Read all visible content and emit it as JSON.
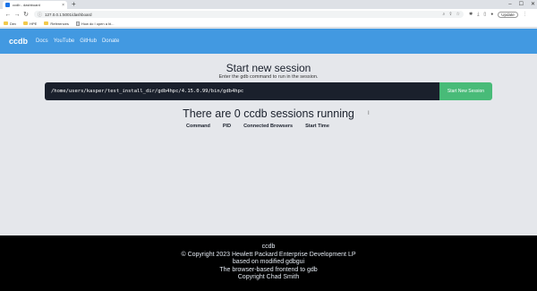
{
  "browser": {
    "tab_title": "ccdb - dashboard",
    "tab_close": "×",
    "new_tab": "+",
    "url": "127.0.0.1:5001/dashboard",
    "update_label": "Update",
    "bookmarks": [
      "Dev",
      "HPE",
      "References",
      "How do I open a bi..."
    ],
    "controls": {
      "minimize": "–",
      "maximize": "☐",
      "close": "✕"
    }
  },
  "nav": {
    "brand": "ccdb",
    "links": [
      "Docs",
      "YouTube",
      "GitHub",
      "Donate"
    ]
  },
  "start": {
    "title": "Start new session",
    "subtitle": "Enter the gdb command to run in the session.",
    "command_value": "/home/users/kasper/test_install_dir/gdb4hpc/4.15.0.99/bin/gdb4hpc",
    "button_label": "Start New Session"
  },
  "sessions": {
    "title": "There are 0 ccdb sessions running",
    "columns": [
      "Command",
      "PID",
      "Connected Browsers",
      "Start Time"
    ]
  },
  "footer": {
    "lines": [
      "ccdb",
      "© Copyright 2023 Hewlett Packard Enterprise Development LP",
      "based on modified gdbgui",
      "The browser-based frontend to gdb",
      "Copyright Chad Smith"
    ]
  },
  "colors": {
    "navbar": "#4299e1",
    "start_button": "#48bb78",
    "command_bg": "#1a202c",
    "page_bg": "#e5e7eb",
    "footer_bg": "#000000"
  }
}
